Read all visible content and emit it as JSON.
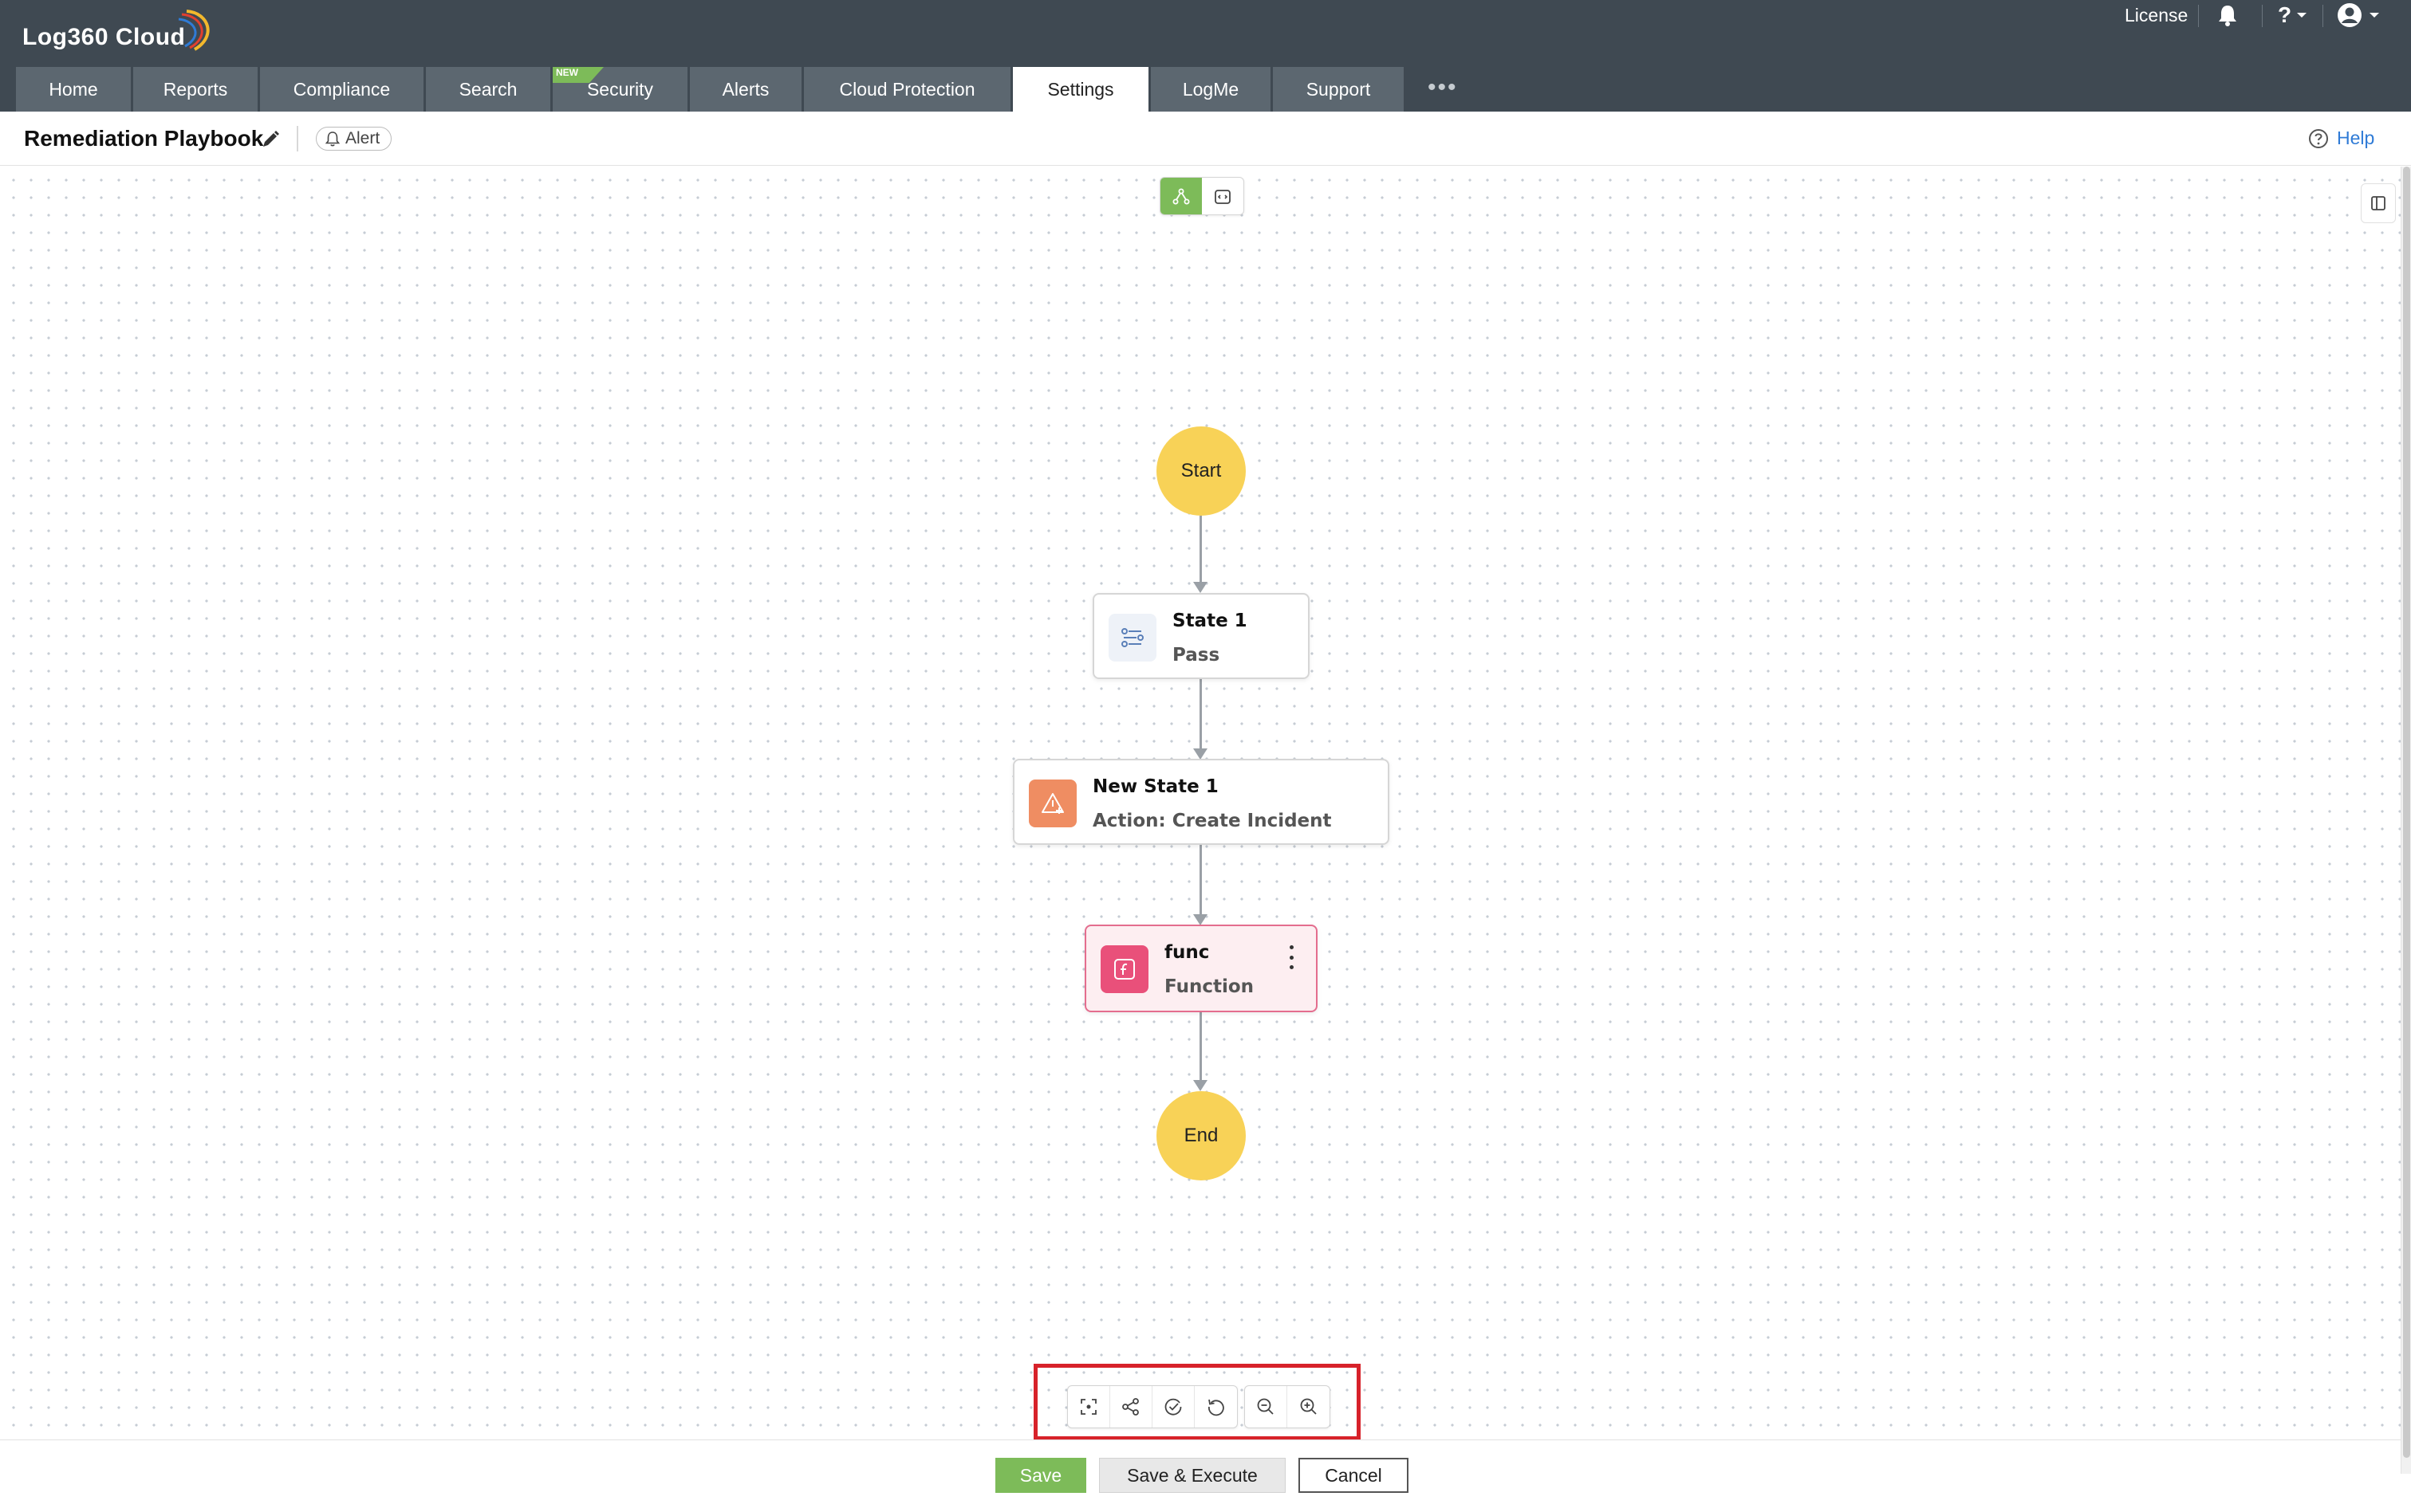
{
  "app": {
    "logo_text": "Log360 Cloud",
    "license_label": "License",
    "help_menu_glyph": "?"
  },
  "nav": {
    "tabs": [
      {
        "label": "Home"
      },
      {
        "label": "Reports"
      },
      {
        "label": "Compliance"
      },
      {
        "label": "Search"
      },
      {
        "label": "Security",
        "badge": "NEW"
      },
      {
        "label": "Alerts"
      },
      {
        "label": "Cloud Protection"
      },
      {
        "label": "Settings",
        "active": true
      },
      {
        "label": "LogMe"
      },
      {
        "label": "Support"
      }
    ],
    "more_glyph": "•••"
  },
  "subheader": {
    "title": "Remediation Playbook",
    "alert_chip": "Alert",
    "help_label": "Help"
  },
  "flow": {
    "start_label": "Start",
    "end_label": "End",
    "nodes": [
      {
        "name": "State 1",
        "type": "Pass",
        "icon": "pass-state-icon"
      },
      {
        "name": "New State 1",
        "type": "Action: Create Incident",
        "icon": "alert-triangle-icon"
      },
      {
        "name": "func",
        "type": "Function",
        "icon": "function-icon"
      }
    ]
  },
  "footer": {
    "save_label": "Save",
    "save_execute_label": "Save & Execute",
    "cancel_label": "Cancel"
  },
  "colors": {
    "header_bg": "#3f4952",
    "tab_bg": "#5c6770",
    "accent_green": "#7dbb59",
    "node_yellow": "#f8d257",
    "action_orange": "#ef8d62",
    "function_pink": "#e9507a",
    "help_blue": "#2f7bd6",
    "highlight_red": "#d7222a"
  }
}
